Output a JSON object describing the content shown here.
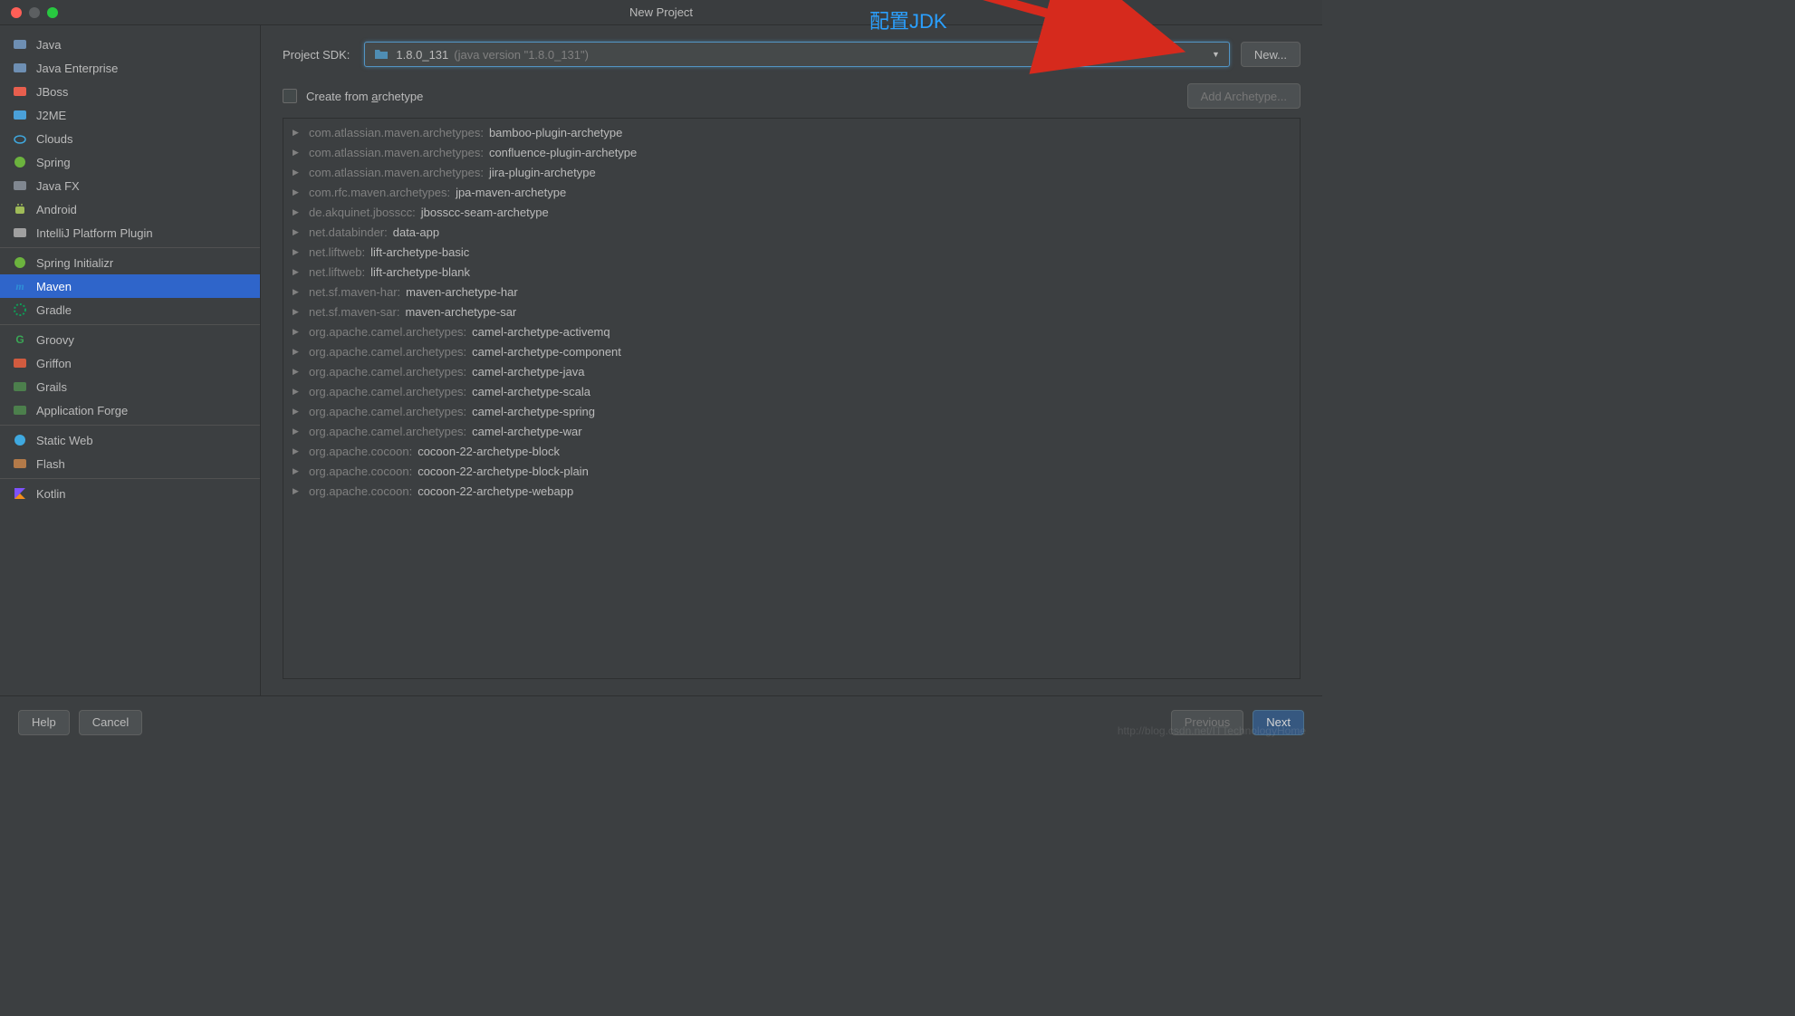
{
  "window": {
    "title": "New Project"
  },
  "annotation": {
    "text": "配置JDK"
  },
  "sidebar": {
    "groups": [
      [
        {
          "icon": "folder-java",
          "iconColor": "#6e8fb3",
          "label": "Java"
        },
        {
          "icon": "folder-ee",
          "iconColor": "#6e8fb3",
          "label": "Java Enterprise"
        },
        {
          "icon": "jboss",
          "iconColor": "#e85f4e",
          "label": "JBoss"
        },
        {
          "icon": "j2me",
          "iconColor": "#4aa0d9",
          "label": "J2ME"
        },
        {
          "icon": "cloud",
          "iconColor": "#3fa9e0",
          "label": "Clouds"
        },
        {
          "icon": "spring",
          "iconColor": "#6cb33e",
          "label": "Spring"
        },
        {
          "icon": "folder-fx",
          "iconColor": "#808790",
          "label": "Java FX"
        },
        {
          "icon": "android",
          "iconColor": "#9fbb58",
          "label": "Android"
        },
        {
          "icon": "plugin",
          "iconColor": "#a0a0a0",
          "label": "IntelliJ Platform Plugin"
        }
      ],
      [
        {
          "icon": "spring-init",
          "iconColor": "#6cb33e",
          "label": "Spring Initializr"
        },
        {
          "icon": "maven",
          "iconColor": "#2f8ed6",
          "label": "Maven",
          "selected": true
        },
        {
          "icon": "gradle",
          "iconColor": "#0f9d58",
          "label": "Gradle"
        }
      ],
      [
        {
          "icon": "groovy",
          "iconColor": "#3aa655",
          "label": "Groovy"
        },
        {
          "icon": "griffon",
          "iconColor": "#d15b3f",
          "label": "Griffon"
        },
        {
          "icon": "grails",
          "iconColor": "#4c7f4c",
          "label": "Grails"
        },
        {
          "icon": "appforge",
          "iconColor": "#4c7f4c",
          "label": "Application Forge"
        }
      ],
      [
        {
          "icon": "staticweb",
          "iconColor": "#3fa9e0",
          "label": "Static Web"
        },
        {
          "icon": "flash",
          "iconColor": "#b37a49",
          "label": "Flash"
        }
      ],
      [
        {
          "icon": "kotlin",
          "iconColor": "#7f52ff",
          "label": "Kotlin"
        }
      ]
    ]
  },
  "sdk": {
    "label": "Project SDK:",
    "name": "1.8.0_131",
    "version": "(java version \"1.8.0_131\")",
    "newButton": "New..."
  },
  "archetype": {
    "checkboxLabelPre": "Create from ",
    "checkboxLabelU": "a",
    "checkboxLabelPost": "rchetype",
    "addButton": "Add Archetype...",
    "items": [
      {
        "prefix": "com.atlassian.maven.archetypes:",
        "name": "bamboo-plugin-archetype"
      },
      {
        "prefix": "com.atlassian.maven.archetypes:",
        "name": "confluence-plugin-archetype"
      },
      {
        "prefix": "com.atlassian.maven.archetypes:",
        "name": "jira-plugin-archetype"
      },
      {
        "prefix": "com.rfc.maven.archetypes:",
        "name": "jpa-maven-archetype"
      },
      {
        "prefix": "de.akquinet.jbosscc:",
        "name": "jbosscc-seam-archetype"
      },
      {
        "prefix": "net.databinder:",
        "name": "data-app"
      },
      {
        "prefix": "net.liftweb:",
        "name": "lift-archetype-basic"
      },
      {
        "prefix": "net.liftweb:",
        "name": "lift-archetype-blank"
      },
      {
        "prefix": "net.sf.maven-har:",
        "name": "maven-archetype-har"
      },
      {
        "prefix": "net.sf.maven-sar:",
        "name": "maven-archetype-sar"
      },
      {
        "prefix": "org.apache.camel.archetypes:",
        "name": "camel-archetype-activemq"
      },
      {
        "prefix": "org.apache.camel.archetypes:",
        "name": "camel-archetype-component"
      },
      {
        "prefix": "org.apache.camel.archetypes:",
        "name": "camel-archetype-java"
      },
      {
        "prefix": "org.apache.camel.archetypes:",
        "name": "camel-archetype-scala"
      },
      {
        "prefix": "org.apache.camel.archetypes:",
        "name": "camel-archetype-spring"
      },
      {
        "prefix": "org.apache.camel.archetypes:",
        "name": "camel-archetype-war"
      },
      {
        "prefix": "org.apache.cocoon:",
        "name": "cocoon-22-archetype-block"
      },
      {
        "prefix": "org.apache.cocoon:",
        "name": "cocoon-22-archetype-block-plain"
      },
      {
        "prefix": "org.apache.cocoon:",
        "name": "cocoon-22-archetype-webapp"
      }
    ]
  },
  "footer": {
    "help": "Help",
    "cancel": "Cancel",
    "previous": "Previous",
    "next": "Next"
  },
  "watermark": "http://blog.csdn.net/ITTechnologyHome"
}
